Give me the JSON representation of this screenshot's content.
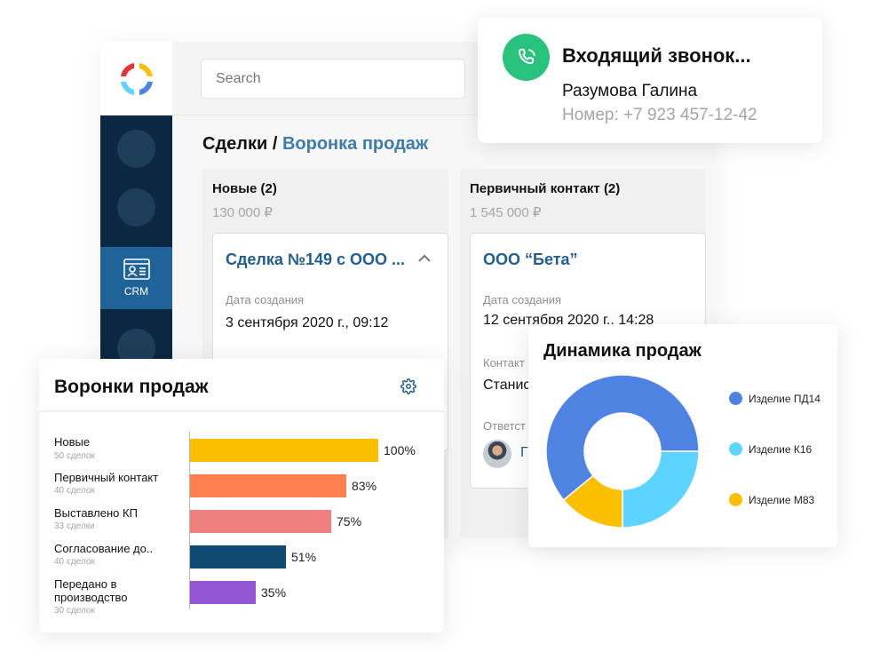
{
  "app": {
    "search": {
      "placeholder": "Search",
      "value": ""
    },
    "sidebar": {
      "items": [
        {
          "label": ""
        },
        {
          "label": ""
        },
        {
          "label": "CRM",
          "active": true,
          "icon": "contact-card-icon"
        },
        {
          "label": ""
        }
      ]
    },
    "breadcrumb": {
      "root": "Сделки",
      "separator": " / ",
      "current": "Воронка продаж"
    },
    "columns": [
      {
        "title": "Новые (2)",
        "sum": "130 000 ₽",
        "deal": {
          "title": "Сделка №149 с ООО ...",
          "created_label": "Дата создания",
          "created_value": "3 сентября 2020 г., 09:12"
        }
      },
      {
        "title": "Первичный контакт (2)",
        "sum": "1 545 000 ₽",
        "deal": {
          "title": "ООО “Бета”",
          "created_label": "Дата создания",
          "created_value": "12 сентября 2020 г., 14:28",
          "contact_label": "Контакт",
          "contact_value": "Станис",
          "responsible_label": "Ответст",
          "responsible_value": "Г"
        }
      }
    ]
  },
  "call": {
    "title": "Входящий звонок...",
    "name": "Разумова Галина",
    "phone": "Номер: +7 923 457-12-42",
    "accent": "#27c27b"
  },
  "funnel": {
    "title": "Воронки продаж",
    "stages": [
      {
        "name": "Новые",
        "count": "50 сделок",
        "percent": 100,
        "label": "100%",
        "color": "#fbbf00"
      },
      {
        "name": "Первичный контакт",
        "count": "40 сделок",
        "percent": 83,
        "label": "83%",
        "color": "#ff7f4f"
      },
      {
        "name": "Выставлено КП",
        "count": "33 сделки",
        "percent": 75,
        "label": "75%",
        "color": "#f08080"
      },
      {
        "name": "Согласование до..",
        "count": "40 сделок",
        "percent": 51,
        "label": "51%",
        "color": "#0f4a73"
      },
      {
        "name": "Передано в производство",
        "count": "30 сделок",
        "percent": 35,
        "label": "35%",
        "color": "#9457d3"
      }
    ]
  },
  "chart_data": {
    "type": "pie",
    "title": "Динамика продаж",
    "donut": true,
    "legend_position": "right",
    "series": [
      {
        "name": "Изделие ПД14",
        "value": 61,
        "color": "#4f83e3"
      },
      {
        "name": "Изделие К16",
        "value": 25,
        "color": "#5cd4ff"
      },
      {
        "name": "Изделие М83",
        "value": 14,
        "color": "#fbbf00"
      }
    ]
  }
}
